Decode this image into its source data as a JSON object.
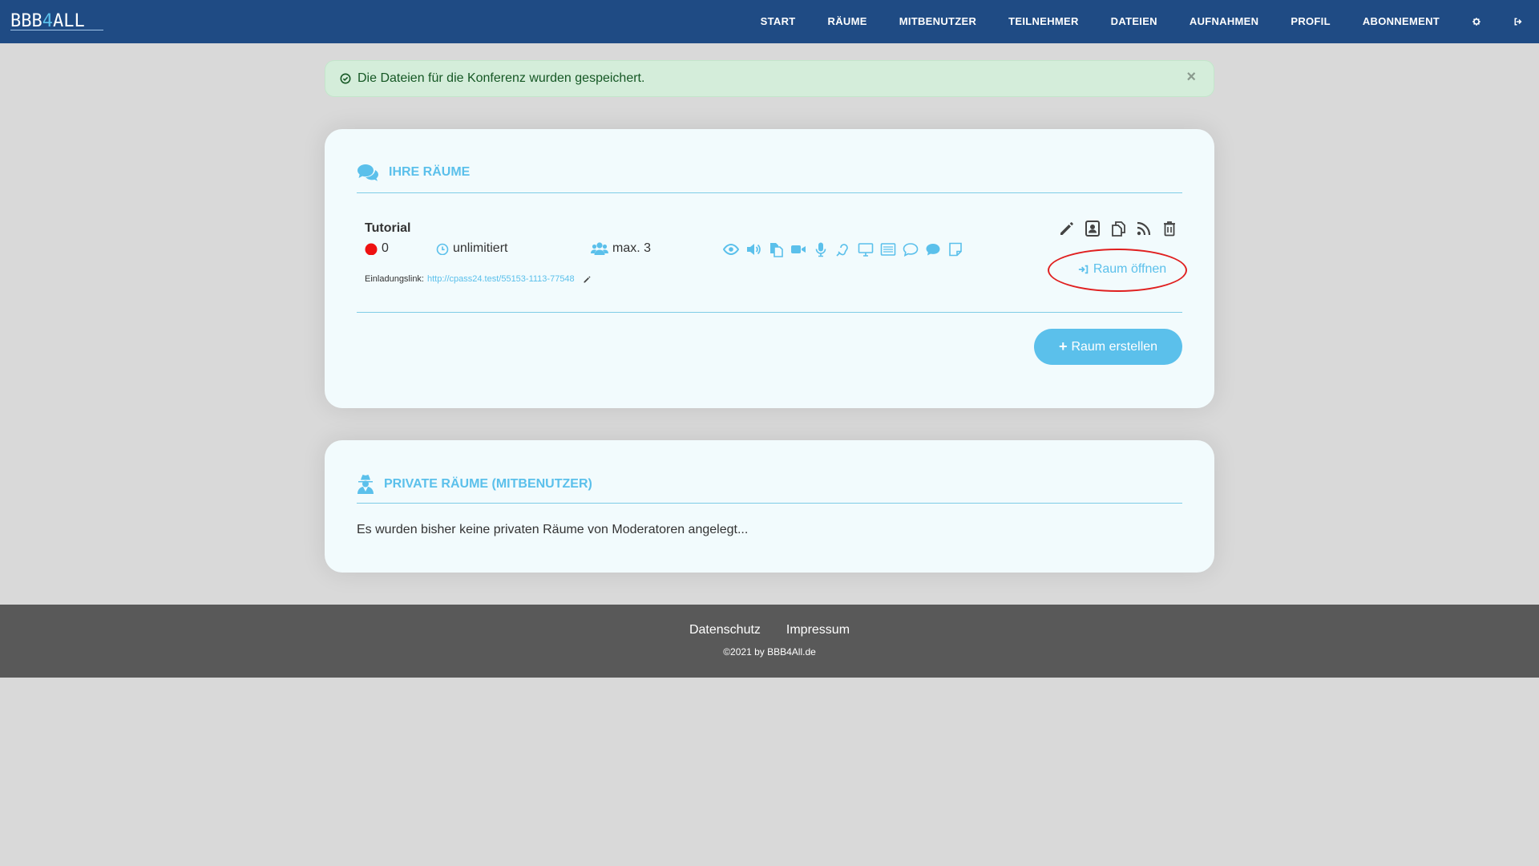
{
  "brand": {
    "prefix": "BBB",
    "four": "4",
    "suffix": "ALL"
  },
  "nav": {
    "items": [
      {
        "label": "START"
      },
      {
        "label": "RÄUME"
      },
      {
        "label": "MITBENUTZER"
      },
      {
        "label": "TEILNEHMER"
      },
      {
        "label": "DATEIEN"
      },
      {
        "label": "AUFNAHMEN"
      },
      {
        "label": "PROFIL"
      },
      {
        "label": "ABONNEMENT"
      }
    ],
    "settings_icon": "gear-icon",
    "logout_icon": "sign-out-icon"
  },
  "alert": {
    "message": "Die Dateien für die Konferenz wurden gespeichert.",
    "close": "×",
    "icon": "check-circle-icon"
  },
  "rooms_card": {
    "title": "IHRE RÄUME",
    "icon": "comments-icon",
    "room": {
      "name": "Tutorial",
      "participants": "0",
      "duration": "unlimitiert",
      "max_users": "max. 3",
      "status_color": "#ee1111",
      "invite_label": "Einladungslink:",
      "invite_url": "http://cpass24.test/55153-1113-77548",
      "open_label": "Raum öffnen",
      "feature_icons": [
        "eye-icon",
        "volume-icon",
        "files-icon",
        "video-icon",
        "microphone-icon",
        "assistive-listening-icon",
        "desktop-icon",
        "list-icon",
        "comment-icon",
        "comment-filled-icon",
        "note-icon"
      ],
      "action_icons": [
        "pencil-icon",
        "contact-icon",
        "copy-icon",
        "rss-icon",
        "trash-icon"
      ]
    },
    "create_label": "Raum erstellen"
  },
  "private_card": {
    "title": "PRIVATE RÄUME (MITBENUTZER)",
    "icon": "user-secret-icon",
    "empty_text": "Es wurden bisher keine privaten Räume von Moderatoren angelegt..."
  },
  "footer": {
    "links": [
      {
        "label": "Datenschutz"
      },
      {
        "label": "Impressum"
      }
    ],
    "copyright": "©2021 by BBB4All.de"
  },
  "colors": {
    "navbar": "#1f4b84",
    "accent": "#5bc0eb",
    "alert_bg": "#d4edda",
    "footer": "#595959",
    "highlight": "#e02020"
  }
}
